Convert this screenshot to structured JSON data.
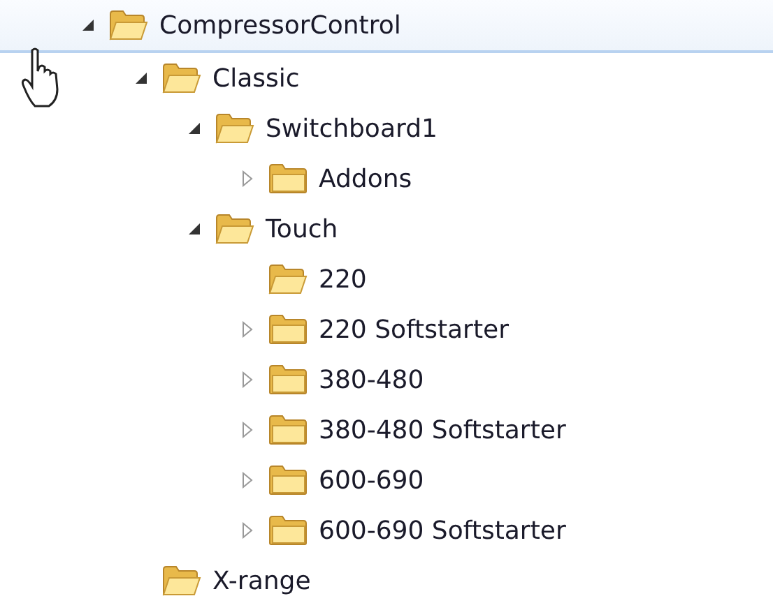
{
  "tree": [
    {
      "label": "CompressorControl",
      "expanded": true,
      "hovered": true,
      "children": [
        {
          "label": "Classic",
          "expanded": true,
          "children": [
            {
              "label": "Switchboard1",
              "expanded": true,
              "children": [
                {
                  "label": "Addons",
                  "expanded": false
                }
              ]
            },
            {
              "label": "Touch",
              "expanded": true,
              "children": [
                {
                  "label": "220"
                },
                {
                  "label": "220 Softstarter",
                  "expanded": false
                },
                {
                  "label": "380-480",
                  "expanded": false
                },
                {
                  "label": "380-480 Softstarter",
                  "expanded": false
                },
                {
                  "label": "600-690",
                  "expanded": false
                },
                {
                  "label": "600-690 Softstarter",
                  "expanded": false
                }
              ]
            }
          ]
        },
        {
          "label": "X-range"
        }
      ]
    }
  ]
}
